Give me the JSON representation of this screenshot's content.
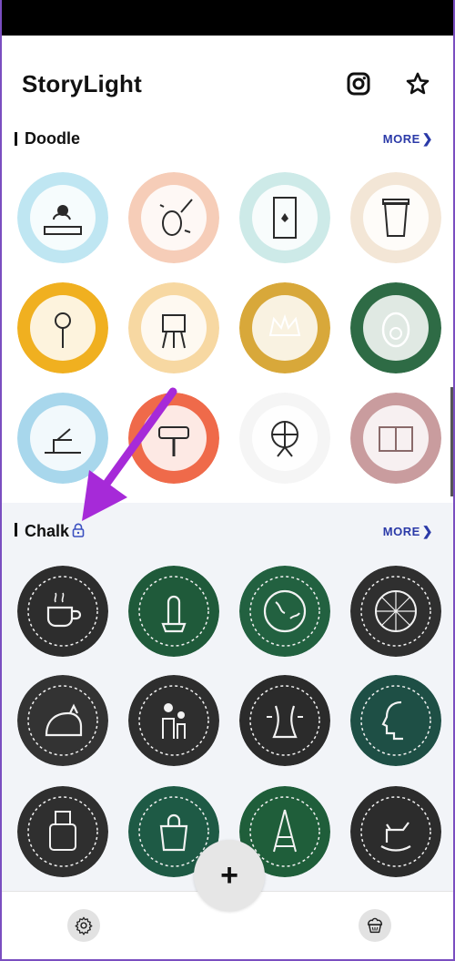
{
  "app": {
    "title": "StoryLight"
  },
  "header": {
    "instagram_icon": "instagram-icon",
    "favorites_icon": "star-icon"
  },
  "sections": [
    {
      "title": "Doodle",
      "more_label": "MORE",
      "locked": false,
      "stickers": [
        {
          "name": "doodle-spa",
          "bg": "#bfe6f2"
        },
        {
          "name": "doodle-violin",
          "bg": "#f6cdb8"
        },
        {
          "name": "doodle-film",
          "bg": "#cdeae8"
        },
        {
          "name": "doodle-coffee-cup",
          "bg": "#f3e6d6"
        },
        {
          "name": "doodle-lollipop",
          "bg": "#f0b020"
        },
        {
          "name": "doodle-easel",
          "bg": "#f7d8a2"
        },
        {
          "name": "doodle-crown",
          "bg": "#d8a83a"
        },
        {
          "name": "doodle-avocado",
          "bg": "#2e6b45"
        },
        {
          "name": "doodle-fishing",
          "bg": "#a8d7ec"
        },
        {
          "name": "doodle-paint-roller",
          "bg": "#ef6a4a"
        },
        {
          "name": "doodle-ferris-wheel",
          "bg": "#f5f5f5"
        },
        {
          "name": "doodle-gift-card",
          "bg": "#c99c9e"
        }
      ]
    },
    {
      "title": "Chalk",
      "more_label": "MORE",
      "locked": true,
      "stickers": [
        {
          "name": "chalk-coffee",
          "bg": "#2d2d2d"
        },
        {
          "name": "chalk-cactus",
          "bg": "#1f5a3a"
        },
        {
          "name": "chalk-globe",
          "bg": "#226140"
        },
        {
          "name": "chalk-pizza",
          "bg": "#2f2f2f"
        },
        {
          "name": "chalk-cat",
          "bg": "#333333"
        },
        {
          "name": "chalk-family",
          "bg": "#2e2e2e"
        },
        {
          "name": "chalk-waist",
          "bg": "#2b2b2b"
        },
        {
          "name": "chalk-face",
          "bg": "#1e4f45"
        },
        {
          "name": "chalk-nail-polish",
          "bg": "#2f2f2f"
        },
        {
          "name": "chalk-shopping",
          "bg": "#1e5a45"
        },
        {
          "name": "chalk-eiffel",
          "bg": "#1f5e3a"
        },
        {
          "name": "chalk-rocking-horse",
          "bg": "#2c2c2c"
        }
      ]
    }
  ],
  "bottom_bar": {
    "add_label": "+",
    "settings_icon": "gear-icon",
    "store_icon": "cupcake-icon"
  },
  "annotation": {
    "arrow_color": "#a62ad8"
  }
}
